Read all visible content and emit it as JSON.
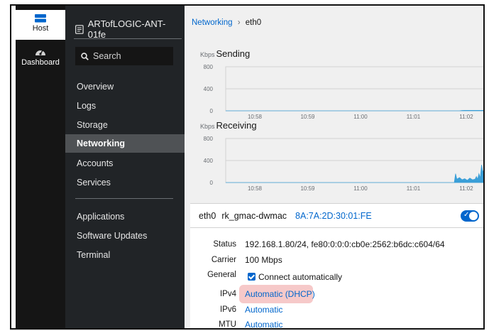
{
  "rail": {
    "host_label": "Host",
    "dashboard_label": "Dashboard",
    "host_icon": "server-icon",
    "dashboard_icon": "gauge-icon"
  },
  "nav": {
    "host_name": "ARTofLOGIC-ANT-01fe",
    "search_placeholder": "Search",
    "items": [
      {
        "label": "Overview",
        "active": false
      },
      {
        "label": "Logs",
        "active": false
      },
      {
        "label": "Storage",
        "active": false
      },
      {
        "label": "Networking",
        "active": true
      },
      {
        "label": "Accounts",
        "active": false
      },
      {
        "label": "Services",
        "active": false
      },
      {
        "label": "Applications",
        "active": false
      },
      {
        "label": "Software Updates",
        "active": false
      },
      {
        "label": "Terminal",
        "active": false
      }
    ]
  },
  "breadcrumb": {
    "parent": "Networking",
    "separator": "›",
    "current": "eth0"
  },
  "charts": {
    "unit": "Kbps",
    "sending_title": "Sending",
    "receiving_title": "Receiving"
  },
  "chart_data": [
    {
      "type": "area",
      "title": "Sending",
      "ylabel": "Kbps",
      "ylim": [
        0,
        800
      ],
      "yticks": [
        "800",
        "400",
        "0"
      ],
      "xticks": [
        "10:58",
        "10:59",
        "11:00",
        "11:01",
        "11:02"
      ],
      "grid": true,
      "x": [
        0,
        0.9,
        0.91,
        0.92,
        0.95,
        0.98,
        1.0
      ],
      "y": [
        0,
        0,
        6,
        8,
        8,
        8,
        8
      ]
    },
    {
      "type": "area",
      "title": "Receiving",
      "ylabel": "Kbps",
      "ylim": [
        0,
        800
      ],
      "yticks": [
        "800",
        "400",
        "0"
      ],
      "xticks": [
        "10:58",
        "10:59",
        "11:00",
        "11:01",
        "11:02"
      ],
      "grid": true,
      "x": [
        0,
        0.88,
        0.885,
        0.89,
        0.9,
        0.91,
        0.92,
        0.93,
        0.94,
        0.95,
        0.96,
        0.965,
        0.97,
        0.975,
        0.98,
        0.985,
        0.99,
        0.995,
        1.0
      ],
      "y": [
        0,
        0,
        160,
        60,
        90,
        50,
        70,
        40,
        80,
        50,
        60,
        110,
        60,
        160,
        80,
        320,
        180,
        260,
        200
      ]
    }
  ],
  "card": {
    "interface": "eth0",
    "driver": "rk_gmac-dwmac",
    "mac": "8A:7A:2D:30:01:FE",
    "enabled": true,
    "rows": {
      "status_label": "Status",
      "status_value": "192.168.1.80/24, fe80:0:0:0:cb0e:2562:b6dc:c604/64",
      "carrier_label": "Carrier",
      "carrier_value": "100 Mbps",
      "general_label": "General",
      "general_value": "Connect automatically",
      "ipv4_label": "IPv4",
      "ipv4_value": "Automatic (DHCP)",
      "ipv6_label": "IPv6",
      "ipv6_value": "Automatic",
      "mtu_label": "MTU",
      "mtu_value": "Automatic"
    }
  },
  "colors": {
    "accent": "#0066cc",
    "chart_fill": "#3a9fd8",
    "highlight": "#f6c9c9"
  }
}
